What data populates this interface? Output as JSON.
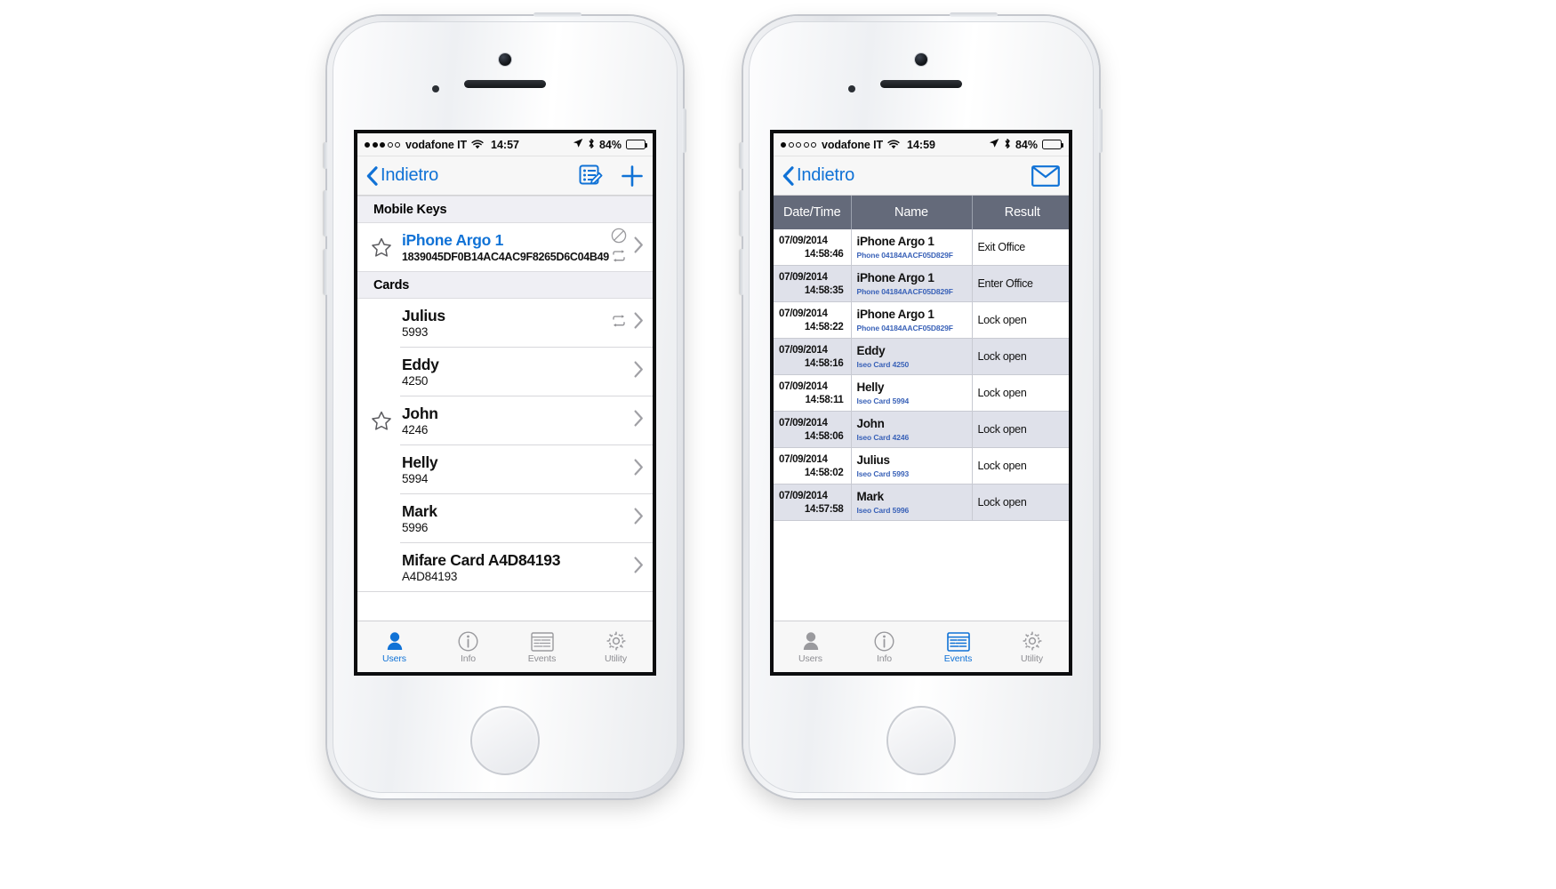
{
  "phone1": {
    "status": {
      "signal_dots_total": 5,
      "signal_dots_filled": 3,
      "carrier": "vodafone IT",
      "time": "14:57",
      "battery_percent": "84%",
      "battery_level": 84
    },
    "nav": {
      "back_label": "Indietro",
      "action_edit": "edit-list-icon",
      "action_add": "plus-icon"
    },
    "sections": [
      {
        "header": "Mobile Keys",
        "rows": [
          {
            "starred": true,
            "title": "iPhone Argo 1",
            "title_is_link": true,
            "subtitle": "1839045DF0B14AC4AC9F8265D6C04B49",
            "subtitle_mono": true,
            "badges": [
              "no-entry-icon",
              "sync-icon"
            ]
          }
        ]
      },
      {
        "header": "Cards",
        "rows": [
          {
            "starred": false,
            "title": "Julius",
            "subtitle": "5993",
            "badges": [
              "sync-icon"
            ]
          },
          {
            "starred": false,
            "title": "Eddy",
            "subtitle": "4250",
            "badges": []
          },
          {
            "starred": true,
            "title": "John",
            "subtitle": "4246",
            "badges": []
          },
          {
            "starred": false,
            "title": "Helly",
            "subtitle": "5994",
            "badges": []
          },
          {
            "starred": false,
            "title": "Mark",
            "subtitle": "5996",
            "badges": []
          },
          {
            "starred": false,
            "title": "Mifare Card A4D84193",
            "subtitle": "A4D84193",
            "badges": []
          }
        ]
      }
    ],
    "tabs": [
      {
        "label": "Users",
        "icon": "person-icon",
        "active": true
      },
      {
        "label": "Info",
        "icon": "info-icon",
        "active": false
      },
      {
        "label": "Events",
        "icon": "events-icon",
        "active": false
      },
      {
        "label": "Utility",
        "icon": "gear-icon",
        "active": false
      }
    ]
  },
  "phone2": {
    "status": {
      "signal_dots_total": 5,
      "signal_dots_filled": 1,
      "carrier": "vodafone IT",
      "time": "14:59",
      "battery_percent": "84%",
      "battery_level": 84
    },
    "nav": {
      "back_label": "Indietro",
      "action_mail": "envelope-icon"
    },
    "events_table": {
      "columns": [
        "Date/Time",
        "Name",
        "Result"
      ],
      "rows": [
        {
          "date": "07/09/2014",
          "time": "14:58:46",
          "name": "iPhone Argo 1",
          "detail": "Phone 04184AACF05D829F",
          "result": "Exit Office"
        },
        {
          "date": "07/09/2014",
          "time": "14:58:35",
          "name": "iPhone Argo 1",
          "detail": "Phone 04184AACF05D829F",
          "result": "Enter Office"
        },
        {
          "date": "07/09/2014",
          "time": "14:58:22",
          "name": "iPhone Argo 1",
          "detail": "Phone 04184AACF05D829F",
          "result": "Lock open"
        },
        {
          "date": "07/09/2014",
          "time": "14:58:16",
          "name": "Eddy",
          "detail": "Iseo Card 4250",
          "result": "Lock open"
        },
        {
          "date": "07/09/2014",
          "time": "14:58:11",
          "name": "Helly",
          "detail": "Iseo Card 5994",
          "result": "Lock open"
        },
        {
          "date": "07/09/2014",
          "time": "14:58:06",
          "name": "John",
          "detail": "Iseo Card 4246",
          "result": "Lock open"
        },
        {
          "date": "07/09/2014",
          "time": "14:58:02",
          "name": "Julius",
          "detail": "Iseo Card 5993",
          "result": "Lock open"
        },
        {
          "date": "07/09/2014",
          "time": "14:57:58",
          "name": "Mark",
          "detail": "Iseo Card 5996",
          "result": "Lock open"
        }
      ]
    },
    "tabs": [
      {
        "label": "Users",
        "icon": "person-icon",
        "active": false
      },
      {
        "label": "Info",
        "icon": "info-icon",
        "active": false
      },
      {
        "label": "Events",
        "icon": "events-icon",
        "active": true
      },
      {
        "label": "Utility",
        "icon": "gear-icon",
        "active": false
      }
    ]
  },
  "colors": {
    "accent_blue": "#1072d6",
    "table_header": "#646a7a",
    "table_alt_row": "#dfe1ea",
    "section_header_bg": "#efeff4",
    "detail_blue": "#3a62b8"
  }
}
